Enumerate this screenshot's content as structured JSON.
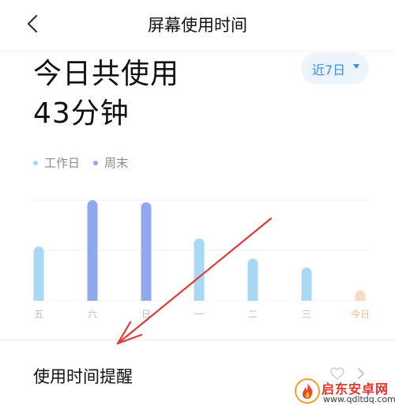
{
  "header": {
    "title": "屏幕使用时间",
    "back_icon": "chevron-left-icon"
  },
  "summary": {
    "line1": "今日共使用",
    "line2": "43分钟"
  },
  "range_selector": {
    "label": "近7日",
    "icon": "caret-down-icon"
  },
  "legend": [
    {
      "label": "工作日",
      "color": "#a9d8f5"
    },
    {
      "label": "周末",
      "color": "#8fa8ee"
    }
  ],
  "chart_data": {
    "type": "bar",
    "categories": [
      "五",
      "六",
      "日",
      "一",
      "二",
      "三",
      "今日"
    ],
    "series": [
      {
        "name": "工作日",
        "values": [
          54,
          null,
          null,
          62,
          42,
          33,
          10
        ]
      },
      {
        "name": "周末",
        "values": [
          null,
          100,
          98,
          null,
          null,
          null,
          null
        ]
      }
    ],
    "highlight_category": "今日",
    "colors": {
      "weekday": "#a9d8f5",
      "weekend": "#8fa8ee",
      "today": "#f8dcc0",
      "today_label": "#f2b98a",
      "axis_label": "#bdbdbd"
    },
    "ylim": [
      0,
      100
    ],
    "grid": true
  },
  "reminder": {
    "label": "使用时间提醒",
    "status_icon": "heart-icon",
    "chevron_icon": "chevron-right-icon"
  },
  "annotation": {
    "arrow_color": "#e23a3a"
  },
  "watermark": {
    "name": "启东安卓网",
    "url": "www.qdltdq.com",
    "logo_icon": "fire-logo-icon"
  }
}
